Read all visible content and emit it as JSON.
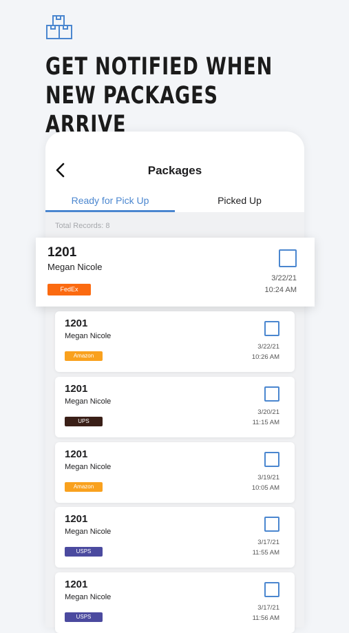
{
  "header": {
    "logo_icon": "stacked-boxes-icon",
    "headline": "GET NOTIFIED WHEN NEW PACKAGES ARRIVE"
  },
  "app": {
    "title": "Packages",
    "back_icon": "chevron-left-icon",
    "tabs": [
      {
        "label": "Ready for Pick Up",
        "active": true
      },
      {
        "label": "Picked Up",
        "active": false
      }
    ],
    "total_records": "Total Records: 8",
    "colors": {
      "accent": "#4a86cf",
      "fedex": "#fb6a10",
      "amazon": "#f9a11e",
      "ups": "#3a1f17",
      "usps": "#4b4a9f"
    },
    "packages": [
      {
        "unit": "1201",
        "name": "Megan Nicole",
        "carrier": "FedEx",
        "carrier_color": "#fb6a10",
        "date": "3/22/21",
        "time": "10:24 AM"
      },
      {
        "unit": "1201",
        "name": "Megan Nicole",
        "carrier": "Amazon",
        "carrier_color": "#f9a11e",
        "date": "3/22/21",
        "time": "10:26 AM"
      },
      {
        "unit": "1201",
        "name": "Megan Nicole",
        "carrier": "UPS",
        "carrier_color": "#3a1f17",
        "date": "3/20/21",
        "time": "11:15 AM"
      },
      {
        "unit": "1201",
        "name": "Megan Nicole",
        "carrier": "Amazon",
        "carrier_color": "#f9a11e",
        "date": "3/19/21",
        "time": "10:05 AM"
      },
      {
        "unit": "1201",
        "name": "Megan Nicole",
        "carrier": "USPS",
        "carrier_color": "#4b4a9f",
        "date": "3/17/21",
        "time": "11:55 AM"
      },
      {
        "unit": "1201",
        "name": "Megan Nicole",
        "carrier": "USPS",
        "carrier_color": "#4b4a9f",
        "date": "3/17/21",
        "time": "11:56 AM"
      }
    ]
  }
}
